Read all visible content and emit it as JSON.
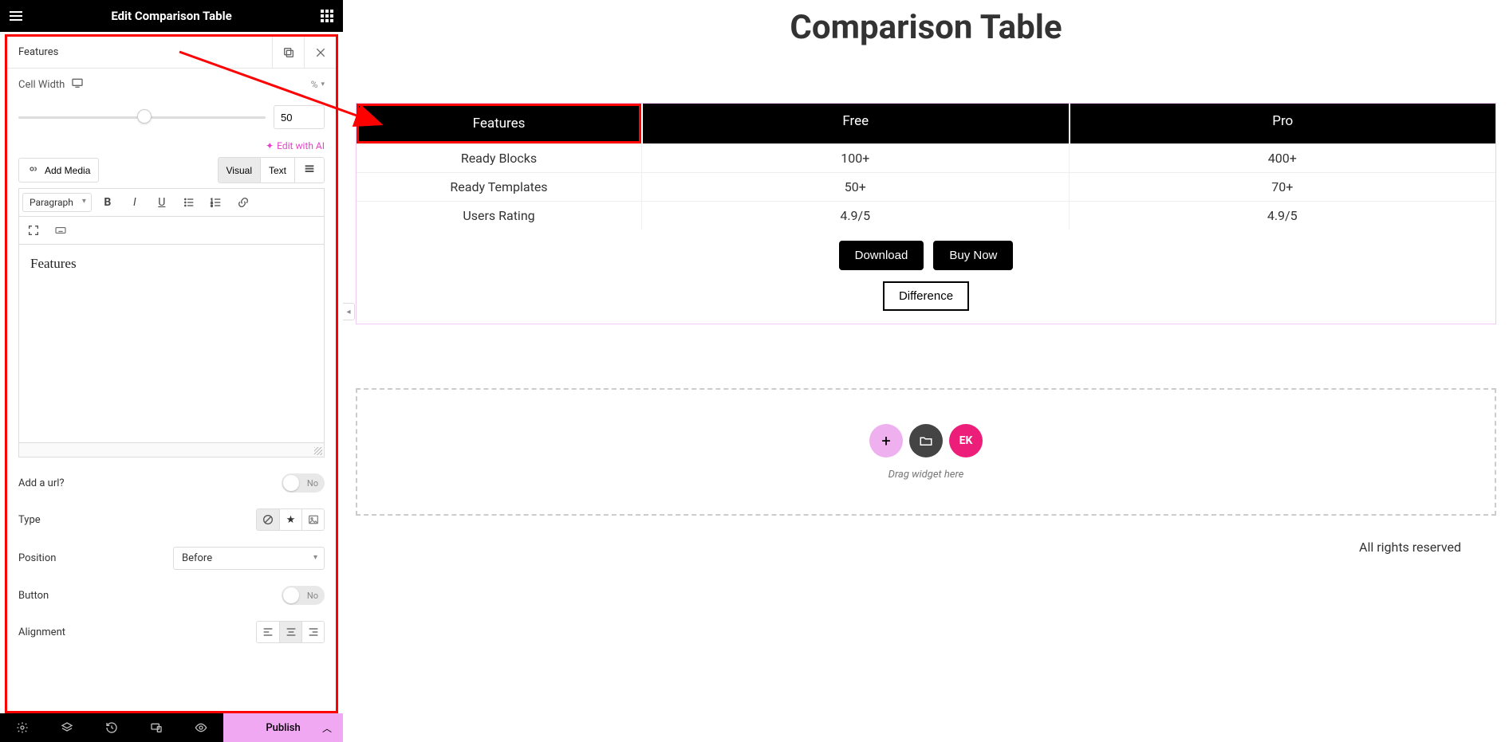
{
  "sidebar": {
    "title": "Edit Comparison Table",
    "section_label": "Features",
    "cell_width_label": "Cell Width",
    "cell_width_unit": "%",
    "cell_width_value": "50",
    "edit_with_ai": "Edit with AI",
    "add_media": "Add Media",
    "tab_visual": "Visual",
    "tab_text": "Text",
    "paragraph": "Paragraph",
    "rte_content": "Features",
    "add_url_label": "Add a url?",
    "add_url_state": "No",
    "type_label": "Type",
    "position_label": "Position",
    "position_value": "Before",
    "button_label": "Button",
    "button_state": "No",
    "alignment_label": "Alignment",
    "publish": "Publish"
  },
  "preview": {
    "title": "Comparison Table",
    "headers": {
      "features": "Features",
      "free": "Free",
      "pro": "Pro"
    },
    "rows": [
      {
        "feature": "Ready Blocks",
        "free": "100+",
        "pro": "400+"
      },
      {
        "feature": "Ready Templates",
        "free": "50+",
        "pro": "70+"
      },
      {
        "feature": "Users Rating",
        "free": "4.9/5",
        "pro": "4.9/5"
      }
    ],
    "download": "Download",
    "buy_now": "Buy Now",
    "difference": "Difference",
    "drag_hint": "Drag widget here",
    "footer": "All rights reserved"
  }
}
